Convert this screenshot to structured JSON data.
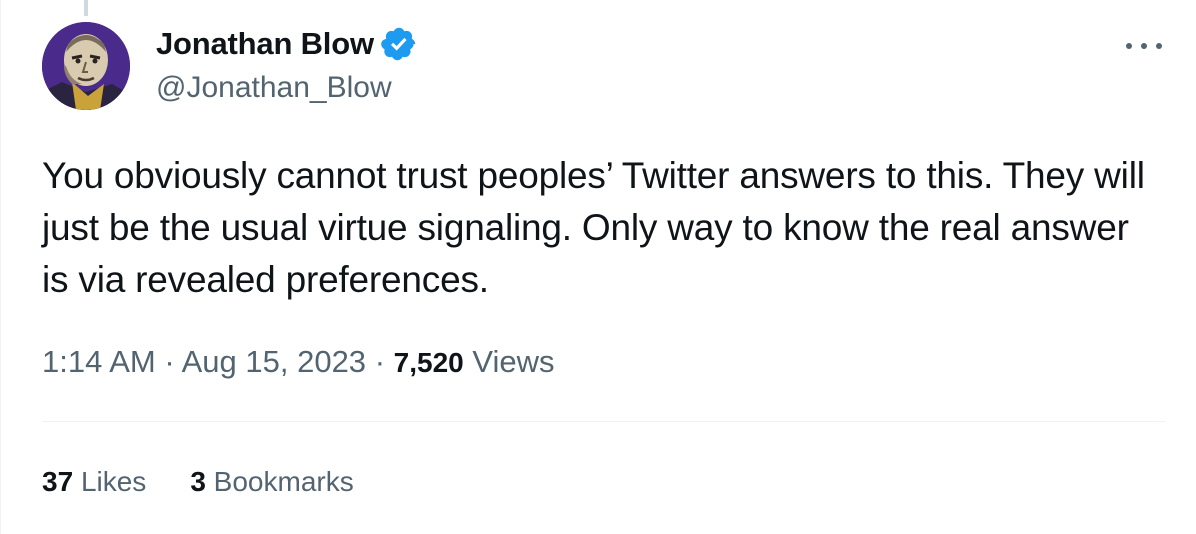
{
  "author": {
    "display_name": "Jonathan Blow",
    "handle": "@Jonathan_Blow",
    "verified": true,
    "verified_color": "#1d9bf0"
  },
  "tweet": {
    "text": "You obviously cannot trust peoples’ Twitter answers to this. They will just be the usual virtue signaling. Only way to know the real answer is via revealed preferences.",
    "time": "1:14 AM",
    "separator": "·",
    "date": "Aug 15, 2023",
    "views_count": "7,520",
    "views_label": "Views"
  },
  "stats": {
    "likes_count": "37",
    "likes_label": "Likes",
    "bookmarks_count": "3",
    "bookmarks_label": "Bookmarks"
  },
  "icons": {
    "more": "more-horizontal-icon",
    "verified": "verified-badge-icon"
  }
}
